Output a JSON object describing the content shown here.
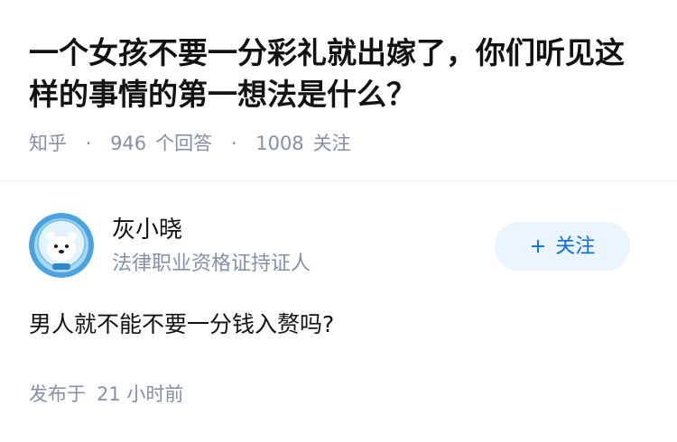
{
  "question": {
    "title": "一个女孩不要一分彩礼就出嫁了，你们听见这样的事情的第一想法是什么？"
  },
  "meta": {
    "source": "知乎",
    "separator": "·",
    "answers_count": "946",
    "answers_label": "个回答",
    "followers_count": "1008",
    "followers_label": "关注"
  },
  "author": {
    "name": "灰小晓",
    "bio": "法律职业资格证持证人",
    "avatar_icon": "polar-bear-astronaut-avatar"
  },
  "follow_button": {
    "icon": "+",
    "label": "关注",
    "color": "#056de8",
    "background": "#ebf5ff"
  },
  "answer": {
    "text": "男人就不能不要一分钱入赘吗?"
  },
  "publish": {
    "label": "发布于",
    "time": "21 小时前"
  }
}
